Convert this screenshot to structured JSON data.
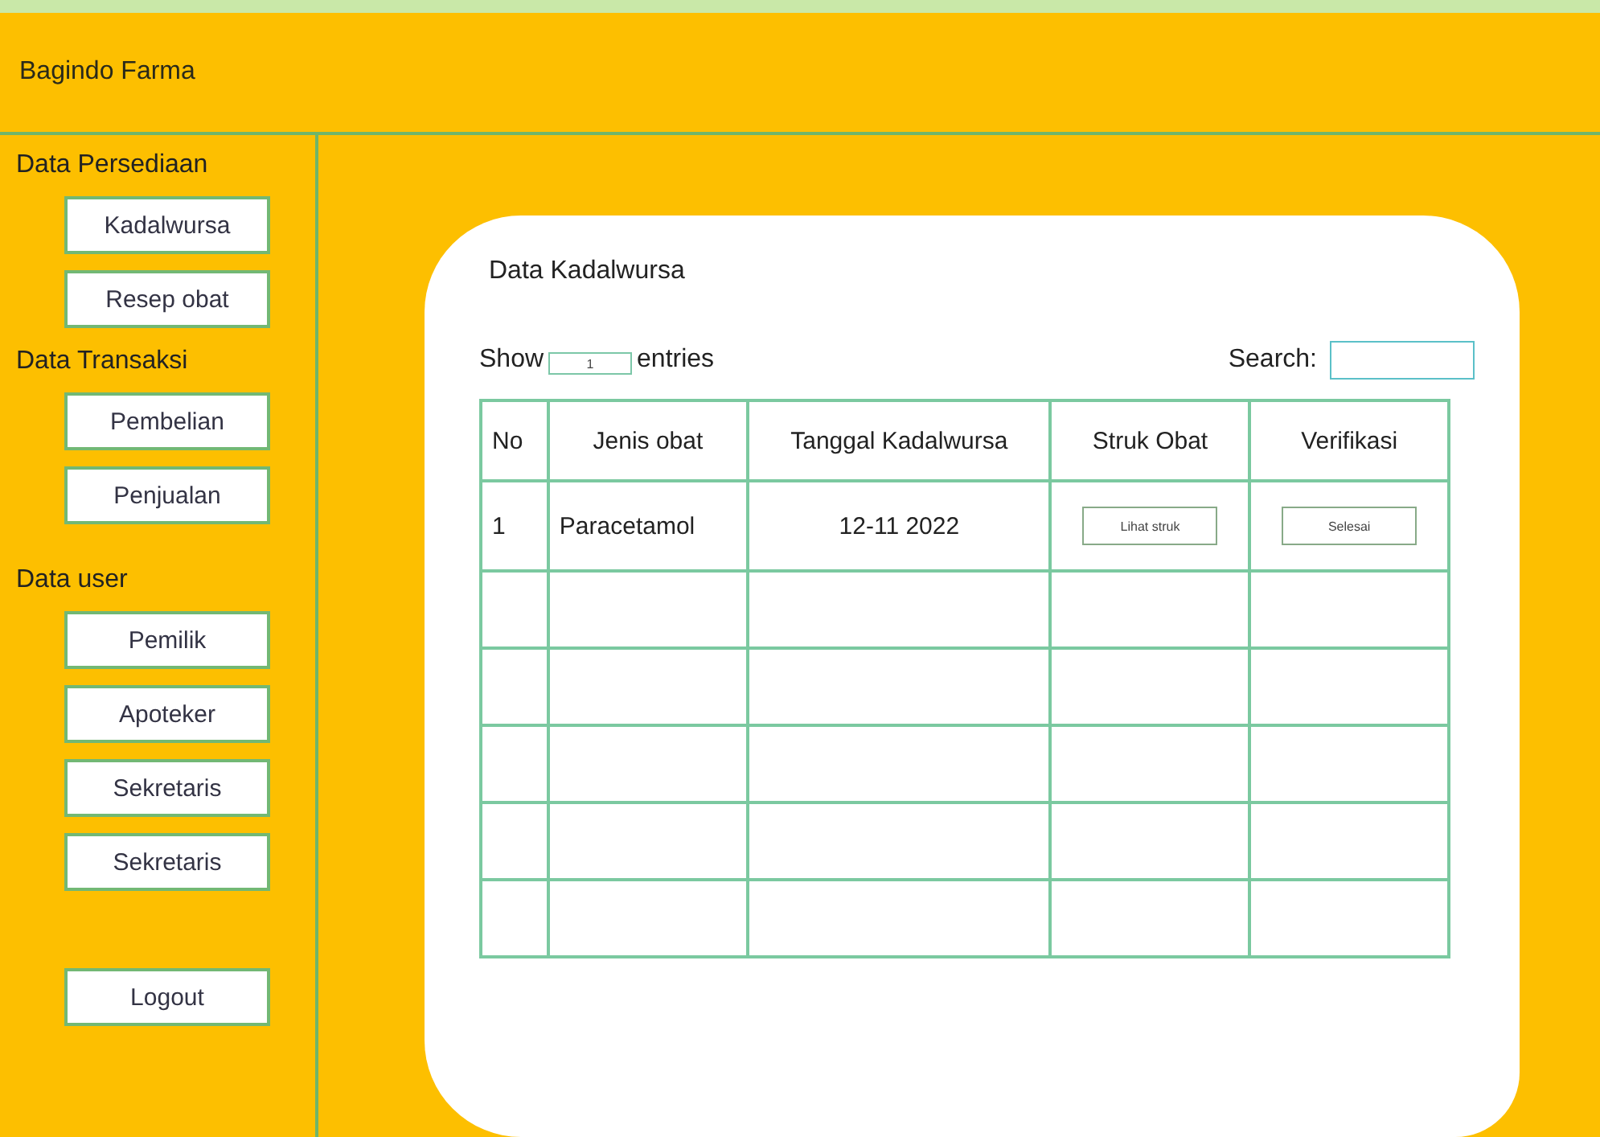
{
  "app_title": "Bagindo Farma",
  "sidebar": {
    "sections": [
      {
        "title": "Data Persediaan",
        "items": [
          "Kadalwursa",
          "Resep obat"
        ]
      },
      {
        "title": "Data Transaksi",
        "items": [
          "Pembelian",
          "Penjualan"
        ]
      },
      {
        "title": "Data user",
        "items": [
          "Pemilik",
          "Apoteker",
          "Sekretaris",
          "Sekretaris"
        ]
      }
    ],
    "logout": "Logout"
  },
  "panel": {
    "title": "Data Kadalwursa",
    "show_label": "Show",
    "entries_select": "1",
    "entries_label": "entries",
    "search_label": "Search:",
    "table": {
      "columns": [
        "No",
        "Jenis obat",
        "Tanggal Kadalwursa",
        "Struk Obat",
        "Verifikasi"
      ],
      "rows": [
        {
          "no": "1",
          "name": "Paracetamol",
          "date": "12-11 2022",
          "receipt_button": "Lihat struk",
          "verify_button": "Selesai"
        }
      ]
    }
  }
}
